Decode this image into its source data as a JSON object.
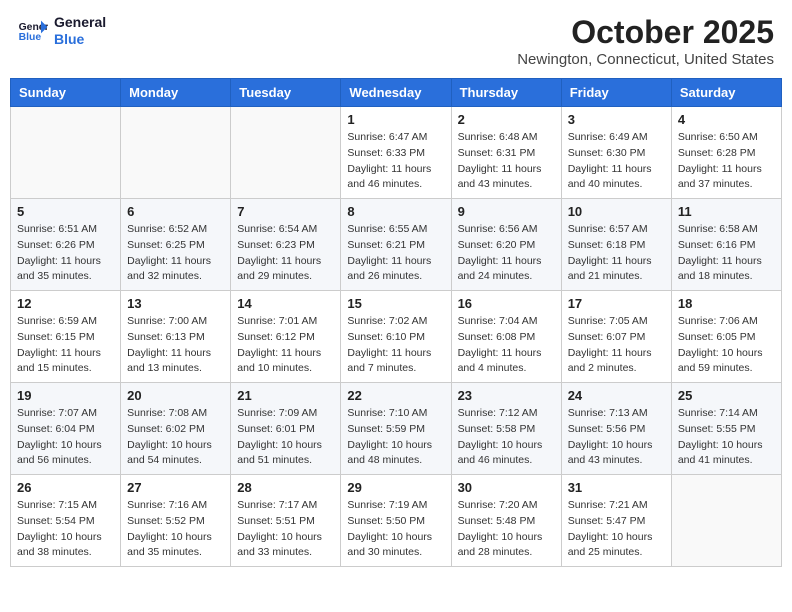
{
  "header": {
    "logo_line1": "General",
    "logo_line2": "Blue",
    "month": "October 2025",
    "location": "Newington, Connecticut, United States"
  },
  "weekdays": [
    "Sunday",
    "Monday",
    "Tuesday",
    "Wednesday",
    "Thursday",
    "Friday",
    "Saturday"
  ],
  "weeks": [
    [
      {
        "day": "",
        "sunrise": "",
        "sunset": "",
        "daylight": ""
      },
      {
        "day": "",
        "sunrise": "",
        "sunset": "",
        "daylight": ""
      },
      {
        "day": "",
        "sunrise": "",
        "sunset": "",
        "daylight": ""
      },
      {
        "day": "1",
        "sunrise": "Sunrise: 6:47 AM",
        "sunset": "Sunset: 6:33 PM",
        "daylight": "Daylight: 11 hours and 46 minutes."
      },
      {
        "day": "2",
        "sunrise": "Sunrise: 6:48 AM",
        "sunset": "Sunset: 6:31 PM",
        "daylight": "Daylight: 11 hours and 43 minutes."
      },
      {
        "day": "3",
        "sunrise": "Sunrise: 6:49 AM",
        "sunset": "Sunset: 6:30 PM",
        "daylight": "Daylight: 11 hours and 40 minutes."
      },
      {
        "day": "4",
        "sunrise": "Sunrise: 6:50 AM",
        "sunset": "Sunset: 6:28 PM",
        "daylight": "Daylight: 11 hours and 37 minutes."
      }
    ],
    [
      {
        "day": "5",
        "sunrise": "Sunrise: 6:51 AM",
        "sunset": "Sunset: 6:26 PM",
        "daylight": "Daylight: 11 hours and 35 minutes."
      },
      {
        "day": "6",
        "sunrise": "Sunrise: 6:52 AM",
        "sunset": "Sunset: 6:25 PM",
        "daylight": "Daylight: 11 hours and 32 minutes."
      },
      {
        "day": "7",
        "sunrise": "Sunrise: 6:54 AM",
        "sunset": "Sunset: 6:23 PM",
        "daylight": "Daylight: 11 hours and 29 minutes."
      },
      {
        "day": "8",
        "sunrise": "Sunrise: 6:55 AM",
        "sunset": "Sunset: 6:21 PM",
        "daylight": "Daylight: 11 hours and 26 minutes."
      },
      {
        "day": "9",
        "sunrise": "Sunrise: 6:56 AM",
        "sunset": "Sunset: 6:20 PM",
        "daylight": "Daylight: 11 hours and 24 minutes."
      },
      {
        "day": "10",
        "sunrise": "Sunrise: 6:57 AM",
        "sunset": "Sunset: 6:18 PM",
        "daylight": "Daylight: 11 hours and 21 minutes."
      },
      {
        "day": "11",
        "sunrise": "Sunrise: 6:58 AM",
        "sunset": "Sunset: 6:16 PM",
        "daylight": "Daylight: 11 hours and 18 minutes."
      }
    ],
    [
      {
        "day": "12",
        "sunrise": "Sunrise: 6:59 AM",
        "sunset": "Sunset: 6:15 PM",
        "daylight": "Daylight: 11 hours and 15 minutes."
      },
      {
        "day": "13",
        "sunrise": "Sunrise: 7:00 AM",
        "sunset": "Sunset: 6:13 PM",
        "daylight": "Daylight: 11 hours and 13 minutes."
      },
      {
        "day": "14",
        "sunrise": "Sunrise: 7:01 AM",
        "sunset": "Sunset: 6:12 PM",
        "daylight": "Daylight: 11 hours and 10 minutes."
      },
      {
        "day": "15",
        "sunrise": "Sunrise: 7:02 AM",
        "sunset": "Sunset: 6:10 PM",
        "daylight": "Daylight: 11 hours and 7 minutes."
      },
      {
        "day": "16",
        "sunrise": "Sunrise: 7:04 AM",
        "sunset": "Sunset: 6:08 PM",
        "daylight": "Daylight: 11 hours and 4 minutes."
      },
      {
        "day": "17",
        "sunrise": "Sunrise: 7:05 AM",
        "sunset": "Sunset: 6:07 PM",
        "daylight": "Daylight: 11 hours and 2 minutes."
      },
      {
        "day": "18",
        "sunrise": "Sunrise: 7:06 AM",
        "sunset": "Sunset: 6:05 PM",
        "daylight": "Daylight: 10 hours and 59 minutes."
      }
    ],
    [
      {
        "day": "19",
        "sunrise": "Sunrise: 7:07 AM",
        "sunset": "Sunset: 6:04 PM",
        "daylight": "Daylight: 10 hours and 56 minutes."
      },
      {
        "day": "20",
        "sunrise": "Sunrise: 7:08 AM",
        "sunset": "Sunset: 6:02 PM",
        "daylight": "Daylight: 10 hours and 54 minutes."
      },
      {
        "day": "21",
        "sunrise": "Sunrise: 7:09 AM",
        "sunset": "Sunset: 6:01 PM",
        "daylight": "Daylight: 10 hours and 51 minutes."
      },
      {
        "day": "22",
        "sunrise": "Sunrise: 7:10 AM",
        "sunset": "Sunset: 5:59 PM",
        "daylight": "Daylight: 10 hours and 48 minutes."
      },
      {
        "day": "23",
        "sunrise": "Sunrise: 7:12 AM",
        "sunset": "Sunset: 5:58 PM",
        "daylight": "Daylight: 10 hours and 46 minutes."
      },
      {
        "day": "24",
        "sunrise": "Sunrise: 7:13 AM",
        "sunset": "Sunset: 5:56 PM",
        "daylight": "Daylight: 10 hours and 43 minutes."
      },
      {
        "day": "25",
        "sunrise": "Sunrise: 7:14 AM",
        "sunset": "Sunset: 5:55 PM",
        "daylight": "Daylight: 10 hours and 41 minutes."
      }
    ],
    [
      {
        "day": "26",
        "sunrise": "Sunrise: 7:15 AM",
        "sunset": "Sunset: 5:54 PM",
        "daylight": "Daylight: 10 hours and 38 minutes."
      },
      {
        "day": "27",
        "sunrise": "Sunrise: 7:16 AM",
        "sunset": "Sunset: 5:52 PM",
        "daylight": "Daylight: 10 hours and 35 minutes."
      },
      {
        "day": "28",
        "sunrise": "Sunrise: 7:17 AM",
        "sunset": "Sunset: 5:51 PM",
        "daylight": "Daylight: 10 hours and 33 minutes."
      },
      {
        "day": "29",
        "sunrise": "Sunrise: 7:19 AM",
        "sunset": "Sunset: 5:50 PM",
        "daylight": "Daylight: 10 hours and 30 minutes."
      },
      {
        "day": "30",
        "sunrise": "Sunrise: 7:20 AM",
        "sunset": "Sunset: 5:48 PM",
        "daylight": "Daylight: 10 hours and 28 minutes."
      },
      {
        "day": "31",
        "sunrise": "Sunrise: 7:21 AM",
        "sunset": "Sunset: 5:47 PM",
        "daylight": "Daylight: 10 hours and 25 minutes."
      },
      {
        "day": "",
        "sunrise": "",
        "sunset": "",
        "daylight": ""
      }
    ]
  ]
}
